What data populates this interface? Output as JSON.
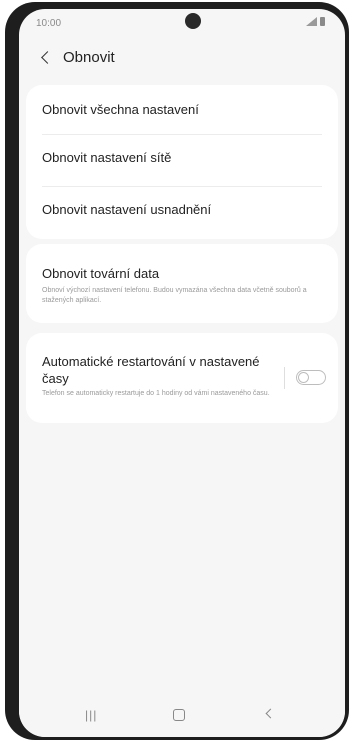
{
  "status_bar": {
    "time": "10:00"
  },
  "header": {
    "title": "Obnovit"
  },
  "reset_group": {
    "items": [
      {
        "label": "Obnovit všechna nastavení"
      },
      {
        "label": "Obnovit nastavení sítě"
      },
      {
        "label": "Obnovit nastavení usnadnění"
      }
    ]
  },
  "factory_reset": {
    "title": "Obnovit tovární data",
    "description": "Obnoví výchozí nastavení telefonu. Budou vymazána všechna data včetně souborů a stažených aplikací."
  },
  "auto_restart": {
    "title": "Automatické restartování v nastavené časy",
    "description": "Telefon se automaticky restartuje do 1 hodiny od vámi nastaveného času.",
    "enabled": false
  },
  "nav_bar": {
    "recent_glyph": "|||",
    "back_glyph": "<"
  },
  "colors": {
    "background": "#f6f6f6",
    "card": "#ffffff",
    "text_primary": "#222222",
    "text_secondary": "#9a9a9a",
    "frame": "#1e1e1e"
  },
  "icons": [
    "back-icon",
    "signal-icon",
    "battery-icon",
    "toggle-switch",
    "recent-apps-icon",
    "home-icon",
    "back-nav-icon"
  ]
}
